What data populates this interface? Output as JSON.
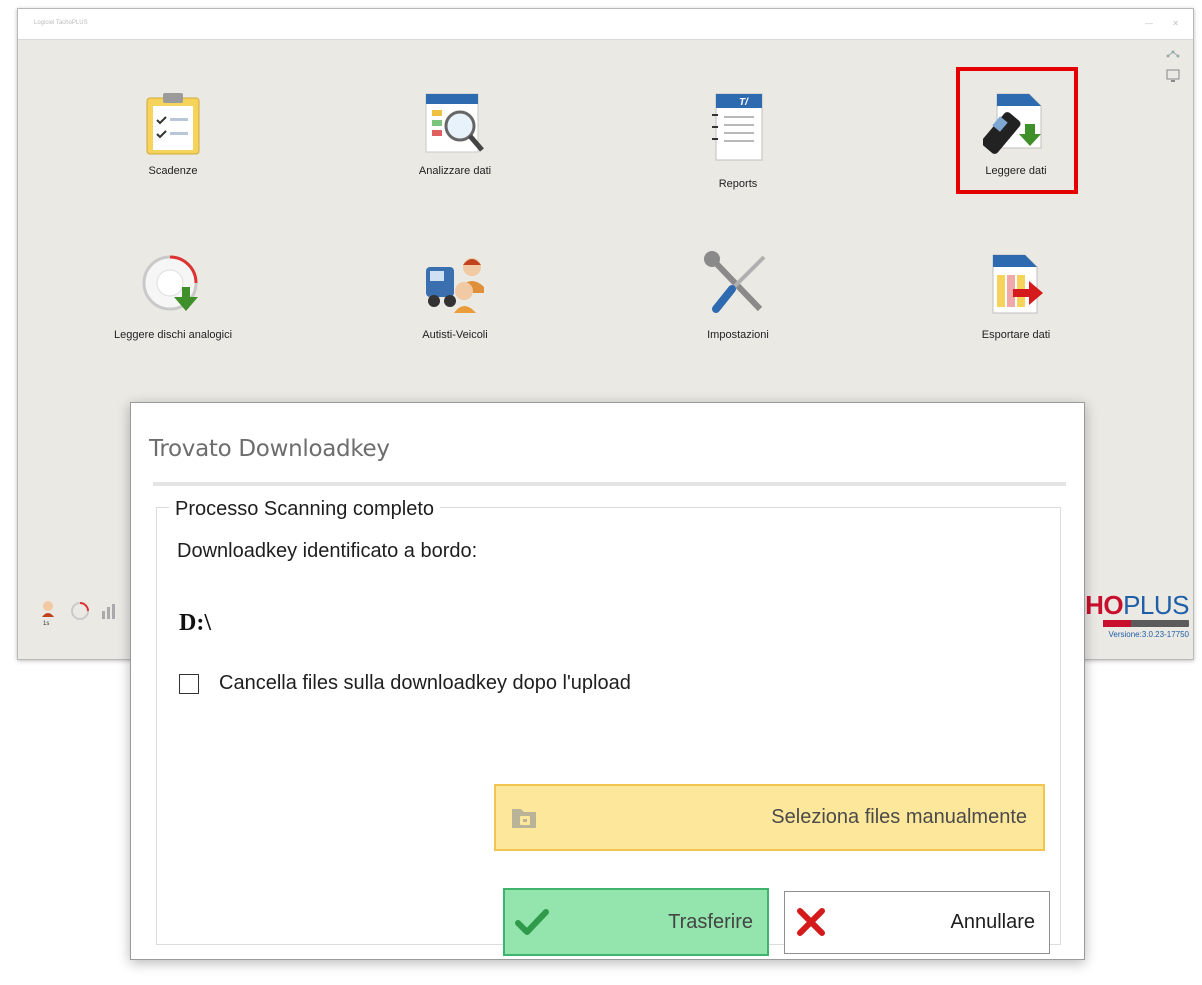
{
  "window": {
    "title": "Logiciel TachoPLUS",
    "minimize": "—",
    "close": "✕"
  },
  "tiles": [
    {
      "label": "Scadenze",
      "icon": "clipboard-checklist-icon"
    },
    {
      "label": "Analizzare dati",
      "icon": "document-magnifier-icon"
    },
    {
      "label": "Reports",
      "icon": "report-document-icon"
    },
    {
      "label": "Leggere dati",
      "icon": "card-reader-download-icon"
    },
    {
      "label": "Leggere dischi analogici",
      "icon": "tachograph-disc-download-icon"
    },
    {
      "label": "Autisti-Veicoli",
      "icon": "truck-drivers-icon"
    },
    {
      "label": "Impostazioni",
      "icon": "wrench-screwdriver-icon"
    },
    {
      "label": "Esportare dati",
      "icon": "export-document-icon"
    }
  ],
  "brand": {
    "logo_ho": "HO",
    "logo_plus": "PLUS",
    "version": "Versione:3.0.23-17750"
  },
  "dialog": {
    "title": "Trovato Downloadkey",
    "group_title": "Processo Scanning completo",
    "found_label": "Downloadkey identificato a bordo:",
    "drive": "D:\\",
    "delete_checkbox_label": "Cancella files sulla downloadkey dopo l'upload",
    "delete_checked": false,
    "select_files_label": "Seleziona files manualmente",
    "transfer_label": "Trasferire",
    "cancel_label": "Annullare"
  },
  "colors": {
    "highlight": "#e40000",
    "select_files_bg": "#fde79a",
    "transfer_bg": "#94e4ad",
    "transfer_check": "#2e9a4a",
    "cancel_x": "#d41a1a"
  }
}
